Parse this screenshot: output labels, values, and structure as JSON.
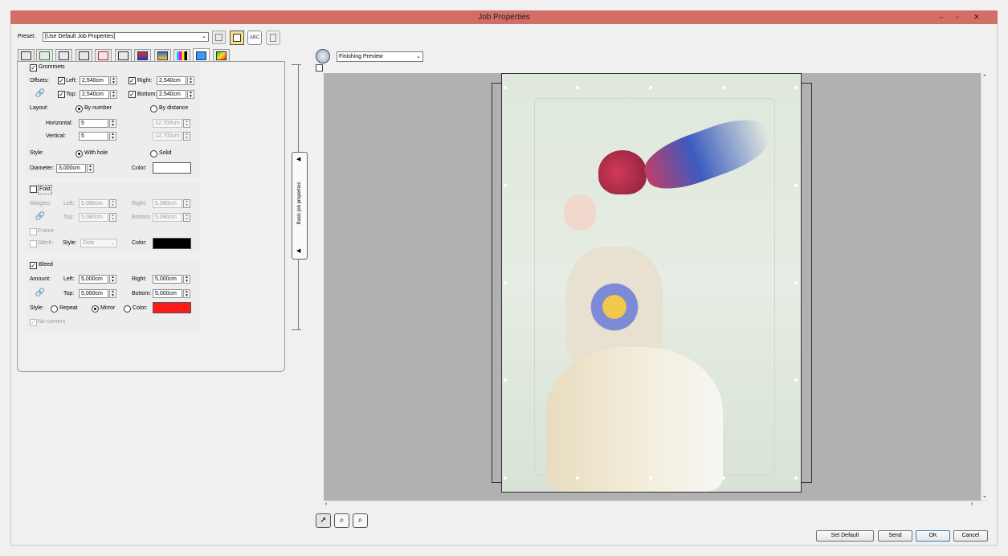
{
  "window": {
    "title": "Job Properties",
    "minimize": "–",
    "restore": "▫",
    "close": "✕"
  },
  "preset": {
    "label": "Preset:",
    "value": "[Use Default Job Properties]"
  },
  "tabs": [
    "layout-icon",
    "import-icon",
    "page-icon",
    "printer-icon",
    "grid-icon",
    "trim-icon",
    "color-icon",
    "stack-icon",
    "cmyk-icon",
    "finishing-icon",
    "profile-icon"
  ],
  "grommets": {
    "title": "Grommets",
    "checked": true,
    "offsets_label": "Offsets:",
    "left_label": "Left:",
    "left": "2,540cm",
    "right_label": "Right:",
    "right": "2,540cm",
    "top_label": "Top:",
    "top": "2,540cm",
    "bottom_label": "Bottom:",
    "bottom": "2,540cm",
    "layout_label": "Layout:",
    "by_number": "By number",
    "by_distance": "By distance",
    "horizontal_label": "Horizontal:",
    "horizontal": "5",
    "horizontal_dist": "12,700cm",
    "vertical_label": "Vertical:",
    "vertical": "5",
    "vertical_dist": "12,700cm",
    "style_label": "Style:",
    "with_hole": "With hole",
    "solid": "Solid",
    "diameter_label": "Diameter:",
    "diameter": "3,000cm",
    "color_label": "Color:",
    "color": "#ffffff"
  },
  "fold": {
    "title": "Fold",
    "checked": false,
    "margins_label": "Margins:",
    "left_label": "Left:",
    "left": "5,080cm",
    "right_label": "Right:",
    "right": "5,080cm",
    "top_label": "Top:",
    "top": "5,080cm",
    "bottom_label": "Bottom:",
    "bottom": "5,080cm",
    "frame_label": "Frame",
    "stitch_label": "Stitch:",
    "style_label": "Style:",
    "style_value": "Dots",
    "color_label": "Color:",
    "color": "#000000"
  },
  "bleed": {
    "title": "Bleed",
    "checked": true,
    "amount_label": "Amount:",
    "left_label": "Left:",
    "left": "5,000cm",
    "right_label": "Right:",
    "right": "5,000cm",
    "top_label": "Top:",
    "top": "5,000cm",
    "bottom_label": "Bottom:",
    "bottom": "5,000cm",
    "style_label": "Style:",
    "repeat": "Repeat",
    "mirror": "Mirror",
    "color_opt": "Color:",
    "color": "#ff1a1a",
    "no_corners": "No corners"
  },
  "side_tab": {
    "label": "Basic job properties"
  },
  "preview": {
    "mode": "Finishing Preview"
  },
  "buttons": {
    "set_default": "Set Default",
    "send": "Send",
    "ok": "OK",
    "cancel": "Cancel"
  }
}
